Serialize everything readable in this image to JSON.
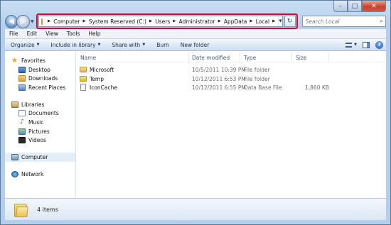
{
  "window": {
    "caption": {
      "minimize": "–",
      "maximize": "□",
      "close": "✕"
    }
  },
  "nav": {
    "back_glyph": "◀",
    "forward_glyph": "▶",
    "history_glyph": "▼"
  },
  "address": {
    "crumbs": [
      "Computer",
      "System Reserved (C:)",
      "Users",
      "Administrator",
      "AppData",
      "Local"
    ],
    "sep": "▶",
    "dropdown_glyph": "▼",
    "refresh_glyph": "↻",
    "highlight_color": "#c8102e"
  },
  "search": {
    "placeholder": "Search Local",
    "icon": "search-icon",
    "glyph": "⌕"
  },
  "menu": {
    "items": [
      "File",
      "Edit",
      "View",
      "Tools",
      "Help"
    ]
  },
  "commands": {
    "organize": "Organize",
    "include_in_library": "Include in library",
    "share_with": "Share with",
    "burn": "Burn",
    "new_folder": "New folder",
    "caret": "▼",
    "help_glyph": "?"
  },
  "navpane": {
    "favorites": {
      "label": "Favorites",
      "items": [
        "Desktop",
        "Downloads",
        "Recent Places"
      ]
    },
    "libraries": {
      "label": "Libraries",
      "items": [
        "Documents",
        "Music",
        "Pictures",
        "Videos"
      ]
    },
    "computer": {
      "label": "Computer"
    },
    "network": {
      "label": "Network"
    }
  },
  "columns": {
    "name": "Name",
    "date": "Date modified",
    "type": "Type",
    "size": "Size"
  },
  "files": [
    {
      "name": "Microsoft",
      "date": "10/5/2011 10:39 PM",
      "type": "File folder",
      "size": "",
      "kind": "folder"
    },
    {
      "name": "Temp",
      "date": "10/12/2011 6:53 PM",
      "type": "File folder",
      "size": "",
      "kind": "folder"
    },
    {
      "name": "IconCache",
      "date": "10/12/2011 6:55 PM",
      "type": "Data Base File",
      "size": "1,860 KB",
      "kind": "file"
    }
  ],
  "details": {
    "item_count": "4 items"
  }
}
